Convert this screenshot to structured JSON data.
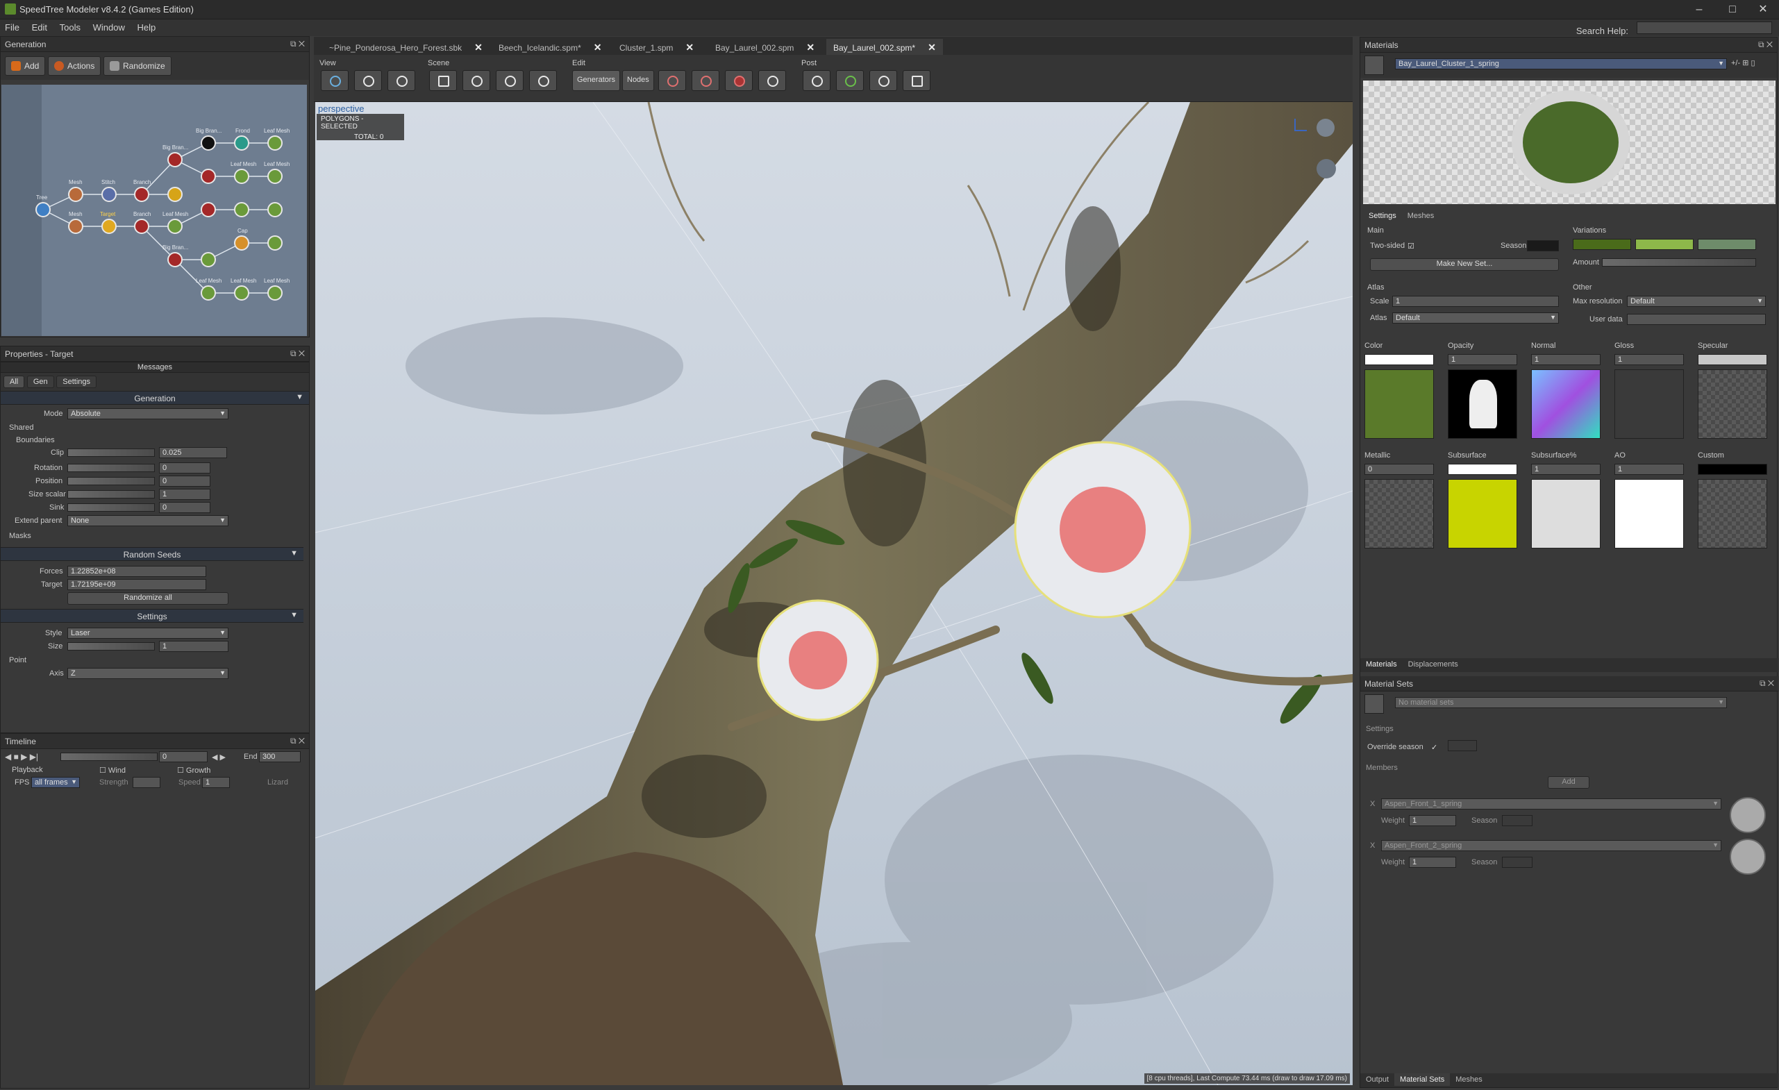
{
  "window": {
    "title": "SpeedTree Modeler v8.4.2 (Games Edition)"
  },
  "menu": {
    "items": [
      "File",
      "Edit",
      "Tools",
      "Window",
      "Help"
    ],
    "search_label": "Search Help:"
  },
  "generation": {
    "title": "Generation",
    "buttons": {
      "add": "Add",
      "actions": "Actions",
      "randomize": "Randomize"
    },
    "nodes": [
      "Tree",
      "Mesh",
      "Stitch",
      "Branch",
      "Big Bran...",
      "Big Bran...",
      "Frond",
      "Leaf Mesh",
      "Leaf Mesh",
      "Leaf Mesh",
      "Leaf Mesh",
      "Leaf Mesh",
      "Leaf Mesh",
      "Mesh",
      "Target",
      "Branch",
      "Big Bran...",
      "Leaf Mesh",
      "Cap",
      "Leaf Mesh",
      "Leaf Mesh",
      "Leaf Mesh",
      "Leaf Mesh"
    ]
  },
  "properties": {
    "title": "Properties - Target",
    "messages": "Messages",
    "tabs": [
      "All",
      "Gen",
      "Settings"
    ],
    "generation_header": "Generation",
    "mode_label": "Mode",
    "mode_value": "Absolute",
    "shared": "Shared",
    "boundaries": "Boundaries",
    "clip_label": "Clip",
    "clip_value": "0.025",
    "rotation_label": "Rotation",
    "rotation_value": "0",
    "position_label": "Position",
    "position_value": "0",
    "size_scalar_label": "Size scalar",
    "size_scalar_value": "1",
    "sink_label": "Sink",
    "sink_value": "0",
    "extend_parent_label": "Extend parent",
    "extend_parent_value": "None",
    "masks": "Masks",
    "random_seeds_header": "Random Seeds",
    "forces_label": "Forces",
    "forces_value": "1.22852e+08",
    "target_label": "Target",
    "target_value": "1.72195e+09",
    "randomize_all": "Randomize all",
    "settings_header": "Settings",
    "style_label": "Style",
    "style_value": "Laser",
    "size_label": "Size",
    "size_value": "1",
    "point": "Point",
    "axis_label": "Axis",
    "axis_value": "Z"
  },
  "timeline": {
    "title": "Timeline",
    "frame_value": "0",
    "end_label": "End",
    "end_value": "300",
    "playback": "Playback",
    "fps_label": "FPS",
    "fps_value": "all frames",
    "wind": "Wind",
    "strength": "Strength",
    "growth": "Growth",
    "speed_label": "Speed",
    "speed_value": "1",
    "lizard": "Lizard"
  },
  "tabs": [
    "~Pine_Ponderosa_Hero_Forest.sbk",
    "Beech_Icelandic.spm*",
    "Cluster_1.spm",
    "Bay_Laurel_002.spm",
    "Bay_Laurel_002.spm*"
  ],
  "toolbar": {
    "groups": [
      "View",
      "Scene",
      "Edit",
      "Post"
    ],
    "generators": "Generators",
    "nodes": "Nodes"
  },
  "viewport": {
    "mode": "perspective",
    "overlay_line1": "POLYGONS - SELECTED",
    "overlay_line2": "TOTAL: 0",
    "status": "[8 cpu threads], Last Compute 73.44 ms (draw to draw 17.09 ms)"
  },
  "materials": {
    "title": "Materials",
    "current": "Bay_Laurel_Cluster_1_spring",
    "subtabs": [
      "Settings",
      "Meshes"
    ],
    "main": "Main",
    "two_sided": "Two-sided",
    "season": "Season",
    "make_new_set": "Make New Set...",
    "variations": "Variations",
    "amount": "Amount",
    "atlas_section": "Atlas",
    "scale_label": "Scale",
    "scale_value": "1",
    "atlas_label": "Atlas",
    "atlas_value": "Default",
    "other": "Other",
    "max_res_label": "Max resolution",
    "max_res_value": "Default",
    "user_data": "User data",
    "maps": [
      {
        "label": "Color",
        "value": ""
      },
      {
        "label": "Opacity",
        "value": "1"
      },
      {
        "label": "Normal",
        "value": "1"
      },
      {
        "label": "Gloss",
        "value": "1"
      },
      {
        "label": "Specular",
        "value": ""
      },
      {
        "label": "Metallic",
        "value": "0"
      },
      {
        "label": "Subsurface",
        "value": ""
      },
      {
        "label": "Subsurface%",
        "value": "1"
      },
      {
        "label": "AO",
        "value": "1"
      },
      {
        "label": "Custom",
        "value": ""
      }
    ],
    "bottom_tabs": [
      "Materials",
      "Displacements"
    ],
    "variation_colors": [
      "#4a6b1a",
      "#8db84a",
      "#6e8c6a"
    ]
  },
  "material_sets": {
    "title": "Material Sets",
    "dropdown": "No material sets",
    "settings": "Settings",
    "override_season": "Override season",
    "members": "Members",
    "add": "Add",
    "items": [
      {
        "name": "Aspen_Front_1_spring",
        "weight": "1",
        "season": "Season",
        "weight_label": "Weight"
      },
      {
        "name": "Aspen_Front_2_spring",
        "weight": "1",
        "season": "Season",
        "weight_label": "Weight"
      }
    ],
    "bottom_tabs": [
      "Output",
      "Material Sets",
      "Meshes"
    ]
  }
}
